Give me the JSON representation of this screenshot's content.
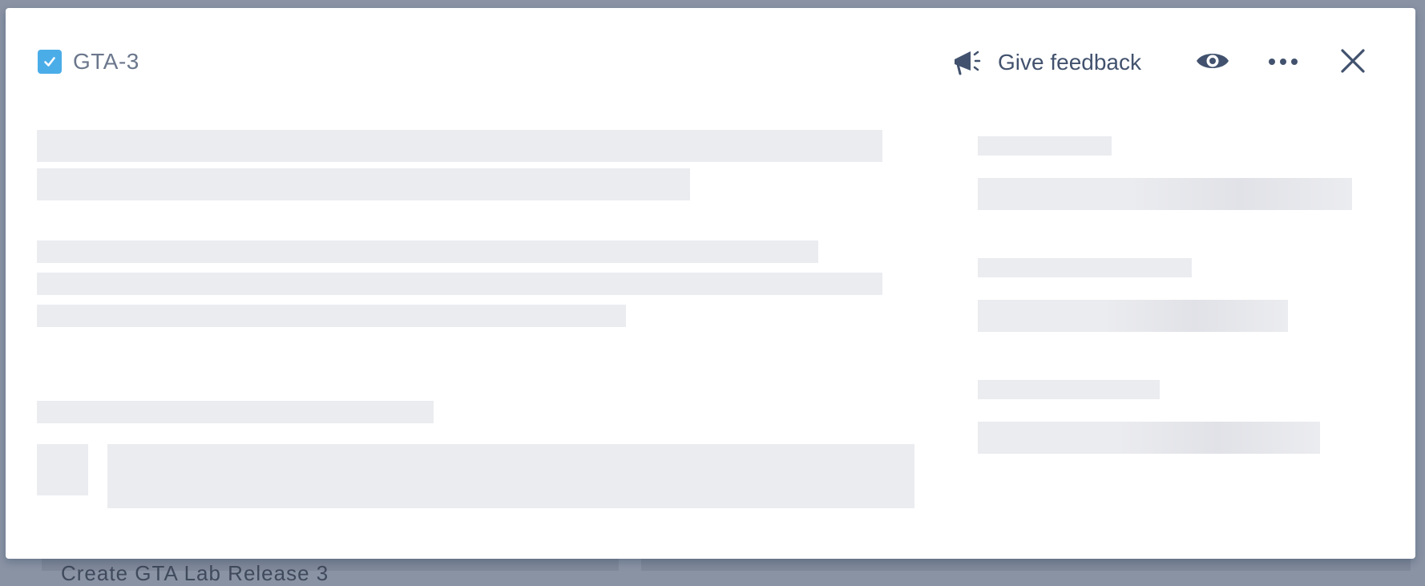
{
  "background": {
    "partial_text": "Create GTA Lab Release 3"
  },
  "modal": {
    "issue_key": "GTA-3",
    "issue_type_icon": "task-checkbox-icon",
    "actions": {
      "feedback_label": "Give feedback",
      "feedback_icon": "megaphone-icon",
      "watch_icon": "eye-icon",
      "more_icon": "ellipsis-icon",
      "close_icon": "close-icon"
    },
    "loading": true
  },
  "colors": {
    "accent": "#4bade8",
    "icon": "#42526e",
    "skeleton": "#ebecf0",
    "backdrop": "#8993a4"
  }
}
